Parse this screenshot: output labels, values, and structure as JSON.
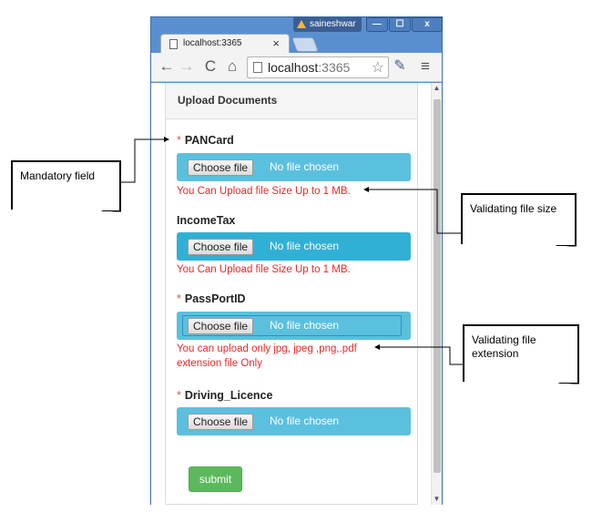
{
  "window": {
    "user": "saineshwar",
    "min": "—",
    "max": "☐",
    "close": "x"
  },
  "tab": {
    "title": "localhost:3365",
    "close": "×"
  },
  "toolbar": {
    "back": "←",
    "forward": "→",
    "reload": "C",
    "home": "⌂",
    "url_host": "localhost",
    "url_port": ":3365",
    "star": "☆",
    "wrench": "✎",
    "menu": "≡"
  },
  "panel": {
    "title": "Upload Documents"
  },
  "fields": [
    {
      "label": "PANCard",
      "required_mark": "*",
      "button": "Choose file",
      "status": "No file chosen",
      "error": "You Can Upload file Size Up to 1 MB."
    },
    {
      "label": "IncomeTax",
      "button": "Choose file",
      "status": "No file chosen",
      "error": "You Can Upload file Size Up to 1 MB."
    },
    {
      "label": "PassPortID",
      "required_mark": "*",
      "button": "Choose file",
      "status": "No file chosen",
      "error_line1": "You can upload only jpg, jpeg ,png,.pdf",
      "error_line2": "extension file Only"
    },
    {
      "label": "Driving_Licence",
      "required_mark": "*",
      "button": "Choose file",
      "status": "No file chosen"
    }
  ],
  "submit": {
    "label": "submit"
  },
  "callouts": {
    "mandatory": "Mandatory field",
    "filesize": "Validating file size",
    "extension_line1": "Validating file",
    "extension_line2": "extension"
  },
  "scrollbar": {
    "up": "▲",
    "down": "▼"
  },
  "colors": {
    "file_bar": "#5bc0de",
    "file_bar_active": "#31b0d5",
    "error_text": "#e52a2a",
    "required_star": "#d9534f",
    "submit": "#5cb85c",
    "chrome_frame": "#5a8fcf"
  }
}
